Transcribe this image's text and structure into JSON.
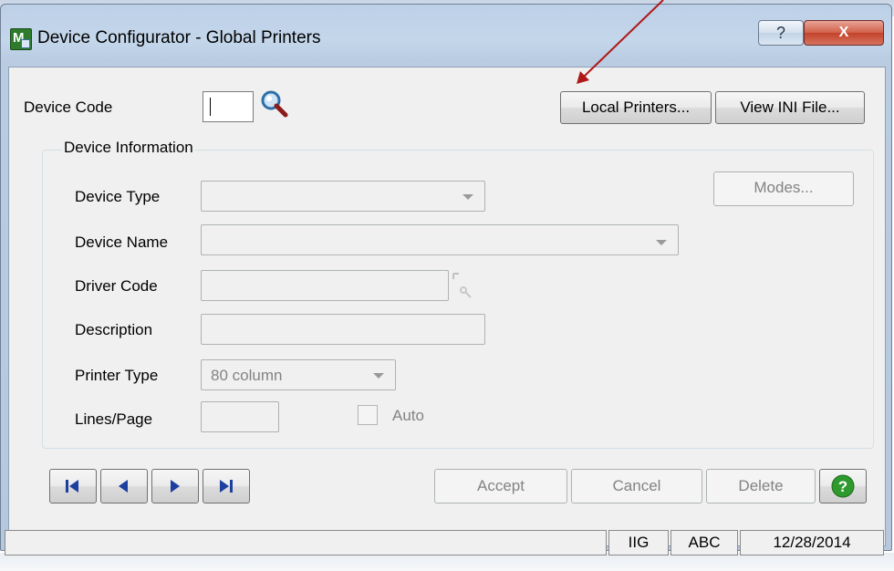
{
  "window": {
    "title": "Device Configurator - Global Printers",
    "help_glyph": "?",
    "close_glyph": "X"
  },
  "header": {
    "device_code_label": "Device Code",
    "device_code_value": "",
    "local_printers_label": "Local Printers...",
    "view_ini_label": "View INI File..."
  },
  "group": {
    "title": "Device Information",
    "device_type_label": "Device Type",
    "device_type_value": "",
    "device_name_label": "Device Name",
    "device_name_value": "",
    "driver_code_label": "Driver Code",
    "driver_code_value": "",
    "description_label": "Description",
    "description_value": "",
    "printer_type_label": "Printer Type",
    "printer_type_value": "80 column",
    "lines_page_label": "Lines/Page",
    "lines_page_value": "",
    "auto_label": "Auto",
    "modes_label": "Modes..."
  },
  "footer": {
    "accept_label": "Accept",
    "cancel_label": "Cancel",
    "delete_label": "Delete"
  },
  "statusbar": {
    "message": "",
    "company_code": "IIG",
    "company_name": "ABC",
    "date": "12/28/2014"
  },
  "colors": {
    "annotation_arrow": "#b01818",
    "help_green": "#2e9a2e"
  }
}
